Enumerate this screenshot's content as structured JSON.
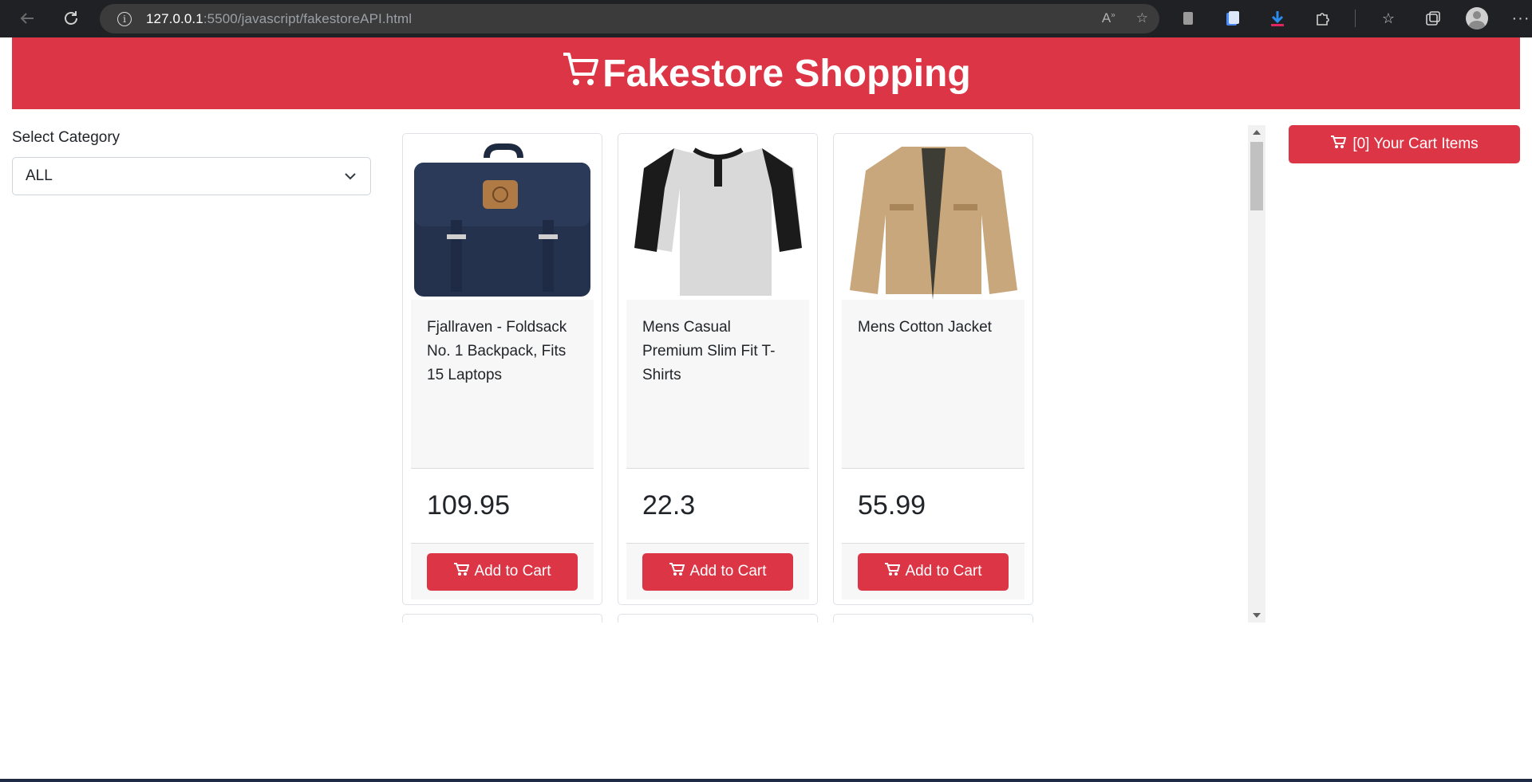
{
  "browser": {
    "url_host": "127.0.0.1",
    "url_rest": ":5500/javascript/fakestoreAPI.html"
  },
  "header": {
    "title": "Fakestore Shopping"
  },
  "sidebar": {
    "category_label": "Select Category",
    "category_selected": "ALL"
  },
  "cart": {
    "label": "[0] Your Cart Items"
  },
  "products": [
    {
      "title": "Fjallraven - Foldsack No. 1 Backpack, Fits 15 Laptops",
      "price": "109.95",
      "button": "Add to Cart"
    },
    {
      "title": "Mens Casual Premium Slim Fit T-Shirts",
      "price": "22.3",
      "button": "Add to Cart"
    },
    {
      "title": "Mens Cotton Jacket",
      "price": "55.99",
      "button": "Add to Cart"
    }
  ],
  "colors": {
    "brand": "#dc3545",
    "chrome": "#202124"
  }
}
